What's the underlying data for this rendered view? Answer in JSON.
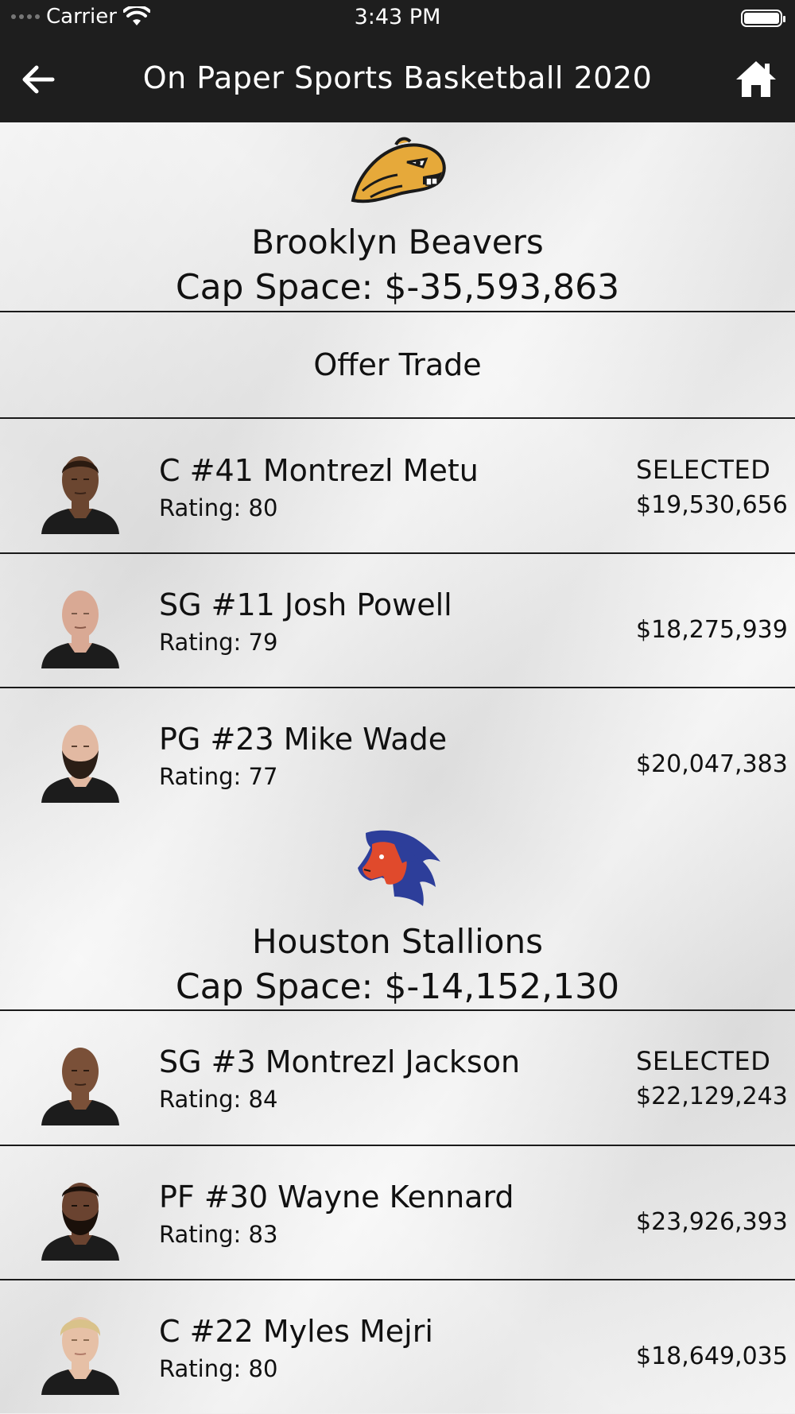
{
  "status_bar": {
    "carrier": "Carrier",
    "time": "3:43 PM"
  },
  "nav": {
    "title": "On Paper Sports Basketball 2020",
    "back_icon": "arrow-left-icon",
    "home_icon": "home-icon"
  },
  "teams": [
    {
      "name": "Brooklyn Beavers",
      "cap_space": "Cap Space: $-35,593,863",
      "logo_icon": "beaver-logo",
      "colors": {
        "primary": "#e6a93a",
        "secondary": "#1a1a1a"
      },
      "offer_trade_label": "Offer Trade",
      "players": [
        {
          "name": "C #41 Montrezl Metu",
          "rating": "Rating: 80",
          "selected": "SELECTED",
          "salary": "$19,530,656",
          "skin": "#6b4630",
          "beard": false
        },
        {
          "name": "SG #11 Josh Powell",
          "rating": "Rating: 79",
          "selected": "",
          "salary": "$18,275,939",
          "skin": "#d9a994",
          "beard": false
        },
        {
          "name": "PG #23 Mike Wade",
          "rating": "Rating: 77",
          "selected": "",
          "salary": "$20,047,383",
          "skin": "#e2b9a2",
          "beard": true
        }
      ]
    },
    {
      "name": "Houston Stallions",
      "cap_space": "Cap Space: $-14,152,130",
      "logo_icon": "stallion-logo",
      "colors": {
        "primary": "#e04a2c",
        "secondary": "#2d3e9a"
      },
      "players": [
        {
          "name": "SG #3 Montrezl Jackson",
          "rating": "Rating: 84",
          "selected": "SELECTED",
          "salary": "$22,129,243",
          "skin": "#7a5038",
          "beard": false
        },
        {
          "name": "PF #30 Wayne Kennard",
          "rating": "Rating: 83",
          "selected": "",
          "salary": "$23,926,393",
          "skin": "#6a4330",
          "beard": true
        },
        {
          "name": "C #22 Myles Mejri",
          "rating": "Rating: 80",
          "selected": "",
          "salary": "$18,649,035",
          "skin": "#e6c0a6",
          "beard": false
        }
      ]
    }
  ]
}
